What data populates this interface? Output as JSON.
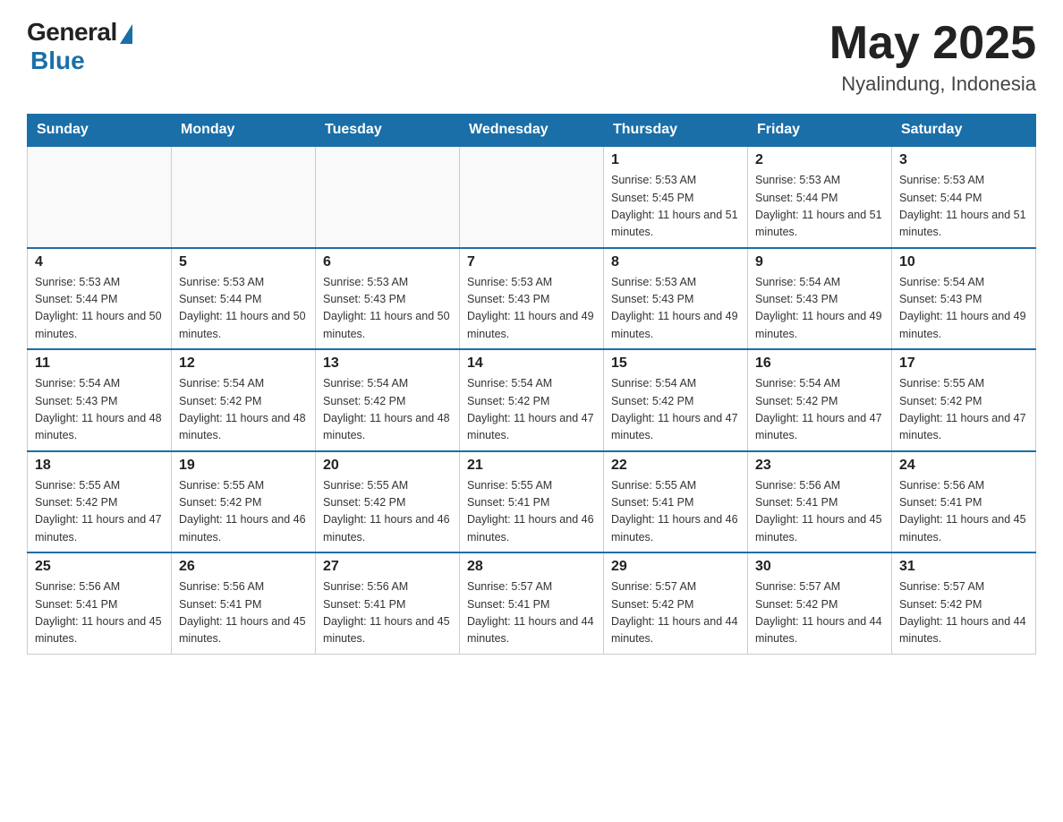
{
  "header": {
    "logo_general": "General",
    "logo_blue": "Blue",
    "month_title": "May 2025",
    "location": "Nyalindung, Indonesia"
  },
  "weekdays": [
    "Sunday",
    "Monday",
    "Tuesday",
    "Wednesday",
    "Thursday",
    "Friday",
    "Saturday"
  ],
  "weeks": [
    [
      {
        "day": "",
        "sunrise": "",
        "sunset": "",
        "daylight": ""
      },
      {
        "day": "",
        "sunrise": "",
        "sunset": "",
        "daylight": ""
      },
      {
        "day": "",
        "sunrise": "",
        "sunset": "",
        "daylight": ""
      },
      {
        "day": "",
        "sunrise": "",
        "sunset": "",
        "daylight": ""
      },
      {
        "day": "1",
        "sunrise": "Sunrise: 5:53 AM",
        "sunset": "Sunset: 5:45 PM",
        "daylight": "Daylight: 11 hours and 51 minutes."
      },
      {
        "day": "2",
        "sunrise": "Sunrise: 5:53 AM",
        "sunset": "Sunset: 5:44 PM",
        "daylight": "Daylight: 11 hours and 51 minutes."
      },
      {
        "day": "3",
        "sunrise": "Sunrise: 5:53 AM",
        "sunset": "Sunset: 5:44 PM",
        "daylight": "Daylight: 11 hours and 51 minutes."
      }
    ],
    [
      {
        "day": "4",
        "sunrise": "Sunrise: 5:53 AM",
        "sunset": "Sunset: 5:44 PM",
        "daylight": "Daylight: 11 hours and 50 minutes."
      },
      {
        "day": "5",
        "sunrise": "Sunrise: 5:53 AM",
        "sunset": "Sunset: 5:44 PM",
        "daylight": "Daylight: 11 hours and 50 minutes."
      },
      {
        "day": "6",
        "sunrise": "Sunrise: 5:53 AM",
        "sunset": "Sunset: 5:43 PM",
        "daylight": "Daylight: 11 hours and 50 minutes."
      },
      {
        "day": "7",
        "sunrise": "Sunrise: 5:53 AM",
        "sunset": "Sunset: 5:43 PM",
        "daylight": "Daylight: 11 hours and 49 minutes."
      },
      {
        "day": "8",
        "sunrise": "Sunrise: 5:53 AM",
        "sunset": "Sunset: 5:43 PM",
        "daylight": "Daylight: 11 hours and 49 minutes."
      },
      {
        "day": "9",
        "sunrise": "Sunrise: 5:54 AM",
        "sunset": "Sunset: 5:43 PM",
        "daylight": "Daylight: 11 hours and 49 minutes."
      },
      {
        "day": "10",
        "sunrise": "Sunrise: 5:54 AM",
        "sunset": "Sunset: 5:43 PM",
        "daylight": "Daylight: 11 hours and 49 minutes."
      }
    ],
    [
      {
        "day": "11",
        "sunrise": "Sunrise: 5:54 AM",
        "sunset": "Sunset: 5:43 PM",
        "daylight": "Daylight: 11 hours and 48 minutes."
      },
      {
        "day": "12",
        "sunrise": "Sunrise: 5:54 AM",
        "sunset": "Sunset: 5:42 PM",
        "daylight": "Daylight: 11 hours and 48 minutes."
      },
      {
        "day": "13",
        "sunrise": "Sunrise: 5:54 AM",
        "sunset": "Sunset: 5:42 PM",
        "daylight": "Daylight: 11 hours and 48 minutes."
      },
      {
        "day": "14",
        "sunrise": "Sunrise: 5:54 AM",
        "sunset": "Sunset: 5:42 PM",
        "daylight": "Daylight: 11 hours and 47 minutes."
      },
      {
        "day": "15",
        "sunrise": "Sunrise: 5:54 AM",
        "sunset": "Sunset: 5:42 PM",
        "daylight": "Daylight: 11 hours and 47 minutes."
      },
      {
        "day": "16",
        "sunrise": "Sunrise: 5:54 AM",
        "sunset": "Sunset: 5:42 PM",
        "daylight": "Daylight: 11 hours and 47 minutes."
      },
      {
        "day": "17",
        "sunrise": "Sunrise: 5:55 AM",
        "sunset": "Sunset: 5:42 PM",
        "daylight": "Daylight: 11 hours and 47 minutes."
      }
    ],
    [
      {
        "day": "18",
        "sunrise": "Sunrise: 5:55 AM",
        "sunset": "Sunset: 5:42 PM",
        "daylight": "Daylight: 11 hours and 47 minutes."
      },
      {
        "day": "19",
        "sunrise": "Sunrise: 5:55 AM",
        "sunset": "Sunset: 5:42 PM",
        "daylight": "Daylight: 11 hours and 46 minutes."
      },
      {
        "day": "20",
        "sunrise": "Sunrise: 5:55 AM",
        "sunset": "Sunset: 5:42 PM",
        "daylight": "Daylight: 11 hours and 46 minutes."
      },
      {
        "day": "21",
        "sunrise": "Sunrise: 5:55 AM",
        "sunset": "Sunset: 5:41 PM",
        "daylight": "Daylight: 11 hours and 46 minutes."
      },
      {
        "day": "22",
        "sunrise": "Sunrise: 5:55 AM",
        "sunset": "Sunset: 5:41 PM",
        "daylight": "Daylight: 11 hours and 46 minutes."
      },
      {
        "day": "23",
        "sunrise": "Sunrise: 5:56 AM",
        "sunset": "Sunset: 5:41 PM",
        "daylight": "Daylight: 11 hours and 45 minutes."
      },
      {
        "day": "24",
        "sunrise": "Sunrise: 5:56 AM",
        "sunset": "Sunset: 5:41 PM",
        "daylight": "Daylight: 11 hours and 45 minutes."
      }
    ],
    [
      {
        "day": "25",
        "sunrise": "Sunrise: 5:56 AM",
        "sunset": "Sunset: 5:41 PM",
        "daylight": "Daylight: 11 hours and 45 minutes."
      },
      {
        "day": "26",
        "sunrise": "Sunrise: 5:56 AM",
        "sunset": "Sunset: 5:41 PM",
        "daylight": "Daylight: 11 hours and 45 minutes."
      },
      {
        "day": "27",
        "sunrise": "Sunrise: 5:56 AM",
        "sunset": "Sunset: 5:41 PM",
        "daylight": "Daylight: 11 hours and 45 minutes."
      },
      {
        "day": "28",
        "sunrise": "Sunrise: 5:57 AM",
        "sunset": "Sunset: 5:41 PM",
        "daylight": "Daylight: 11 hours and 44 minutes."
      },
      {
        "day": "29",
        "sunrise": "Sunrise: 5:57 AM",
        "sunset": "Sunset: 5:42 PM",
        "daylight": "Daylight: 11 hours and 44 minutes."
      },
      {
        "day": "30",
        "sunrise": "Sunrise: 5:57 AM",
        "sunset": "Sunset: 5:42 PM",
        "daylight": "Daylight: 11 hours and 44 minutes."
      },
      {
        "day": "31",
        "sunrise": "Sunrise: 5:57 AM",
        "sunset": "Sunset: 5:42 PM",
        "daylight": "Daylight: 11 hours and 44 minutes."
      }
    ]
  ]
}
